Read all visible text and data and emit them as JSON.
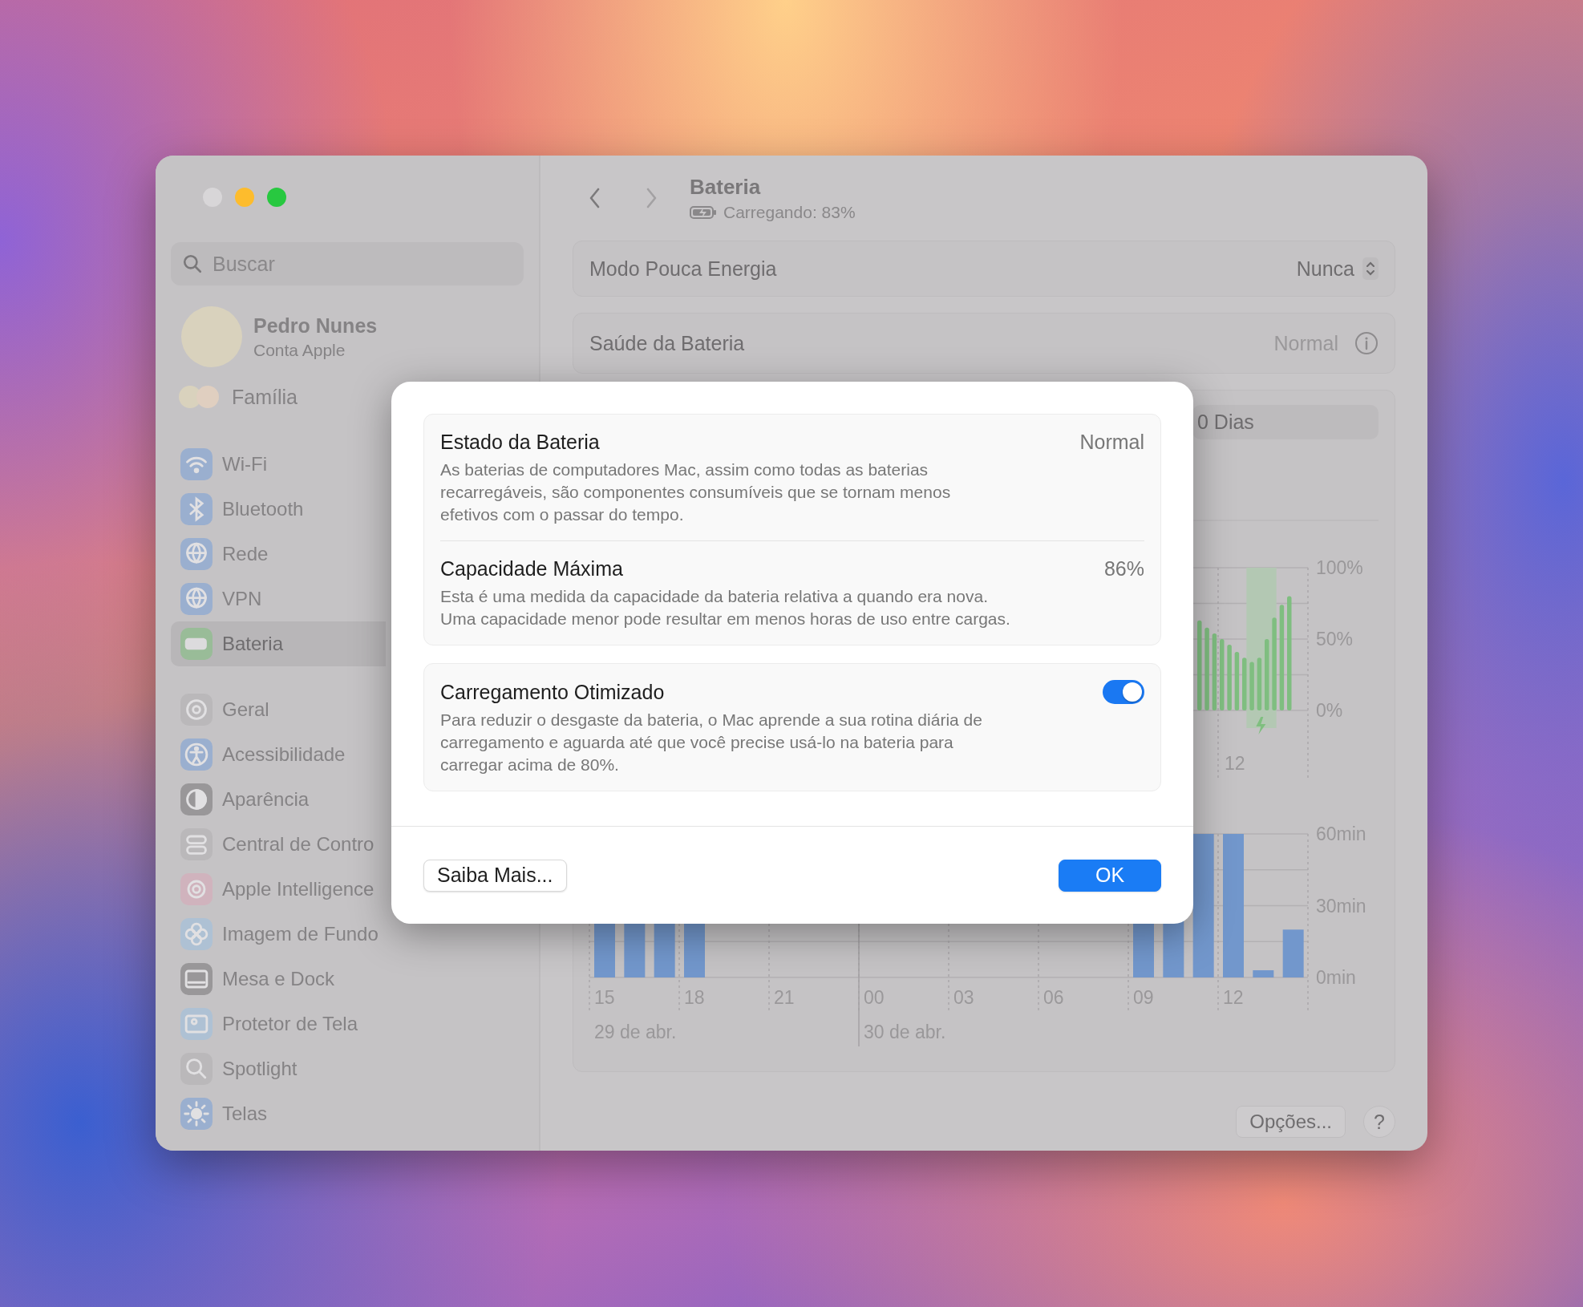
{
  "sidebar": {
    "search": {
      "placeholder": "Buscar"
    },
    "account": {
      "name": "Pedro Nunes",
      "subtitle": "Conta Apple"
    },
    "family": {
      "label": "Família"
    },
    "groups": [
      {
        "items": [
          {
            "label": "Wi-Fi",
            "selected": false
          },
          {
            "label": "Bluetooth",
            "selected": false
          },
          {
            "label": "Rede",
            "selected": false
          },
          {
            "label": "VPN",
            "selected": false
          },
          {
            "label": "Bateria",
            "selected": true
          }
        ]
      },
      {
        "items": [
          {
            "label": "Geral",
            "selected": false
          },
          {
            "label": "Acessibilidade",
            "selected": false
          },
          {
            "label": "Aparência",
            "selected": false
          },
          {
            "label": "Central de Contro",
            "selected": false
          },
          {
            "label": "Apple Intelligence",
            "selected": false
          },
          {
            "label": "Imagem de Fundo",
            "selected": false
          },
          {
            "label": "Mesa e Dock",
            "selected": false
          },
          {
            "label": "Protetor de Tela",
            "selected": false
          },
          {
            "label": "Spotlight",
            "selected": false
          },
          {
            "label": "Telas",
            "selected": false
          }
        ]
      }
    ]
  },
  "header": {
    "title": "Bateria",
    "status": "Carregando: 83%"
  },
  "rows": [
    {
      "label": "Modo Pouca Energia",
      "value": "Nunca",
      "kind": "popup"
    },
    {
      "label": "Saúde da Bateria",
      "value": "Normal",
      "kind": "info"
    }
  ],
  "usage": {
    "range": "0 Dias",
    "level_chart": {
      "y_labels": [
        "100%",
        "50%",
        "0%"
      ],
      "x_labels": [
        "12"
      ]
    },
    "activity_chart": {
      "y_labels": [
        "60min",
        "30min",
        "0min"
      ],
      "x_labels": [
        "15",
        "18",
        "21",
        "00",
        "03",
        "06",
        "09",
        "12"
      ],
      "dates": [
        "29 de abr.",
        "30 de abr."
      ]
    }
  },
  "footer": {
    "options": "Opções...",
    "help": "?"
  },
  "dialog": {
    "sections": [
      {
        "items": [
          {
            "kind": "value",
            "title": "Estado da Bateria",
            "value": "Normal",
            "description": "As baterias de computadores Mac, assim como todas as baterias\nrecarregáveis, são componentes consumíveis que se tornam menos\nefetivos com o passar do tempo."
          },
          {
            "kind": "value",
            "title": "Capacidade Máxima",
            "value": "86%",
            "description": "Esta é uma medida da capacidade da bateria relativa a quando era nova.\nUma capacidade menor pode resultar em menos horas de uso entre cargas."
          }
        ]
      },
      {
        "items": [
          {
            "kind": "toggle",
            "title": "Carregamento Otimizado",
            "on": true,
            "description": "Para reduzir o desgaste da bateria, o Mac aprende a sua rotina diária de\ncarregamento e aguarda até que você precise usá-lo na bateria para\ncarregar acima de 80%."
          }
        ]
      }
    ],
    "buttons": [
      {
        "label": "Saiba Mais...",
        "default": false
      },
      {
        "label": "OK",
        "default": true
      }
    ]
  }
}
